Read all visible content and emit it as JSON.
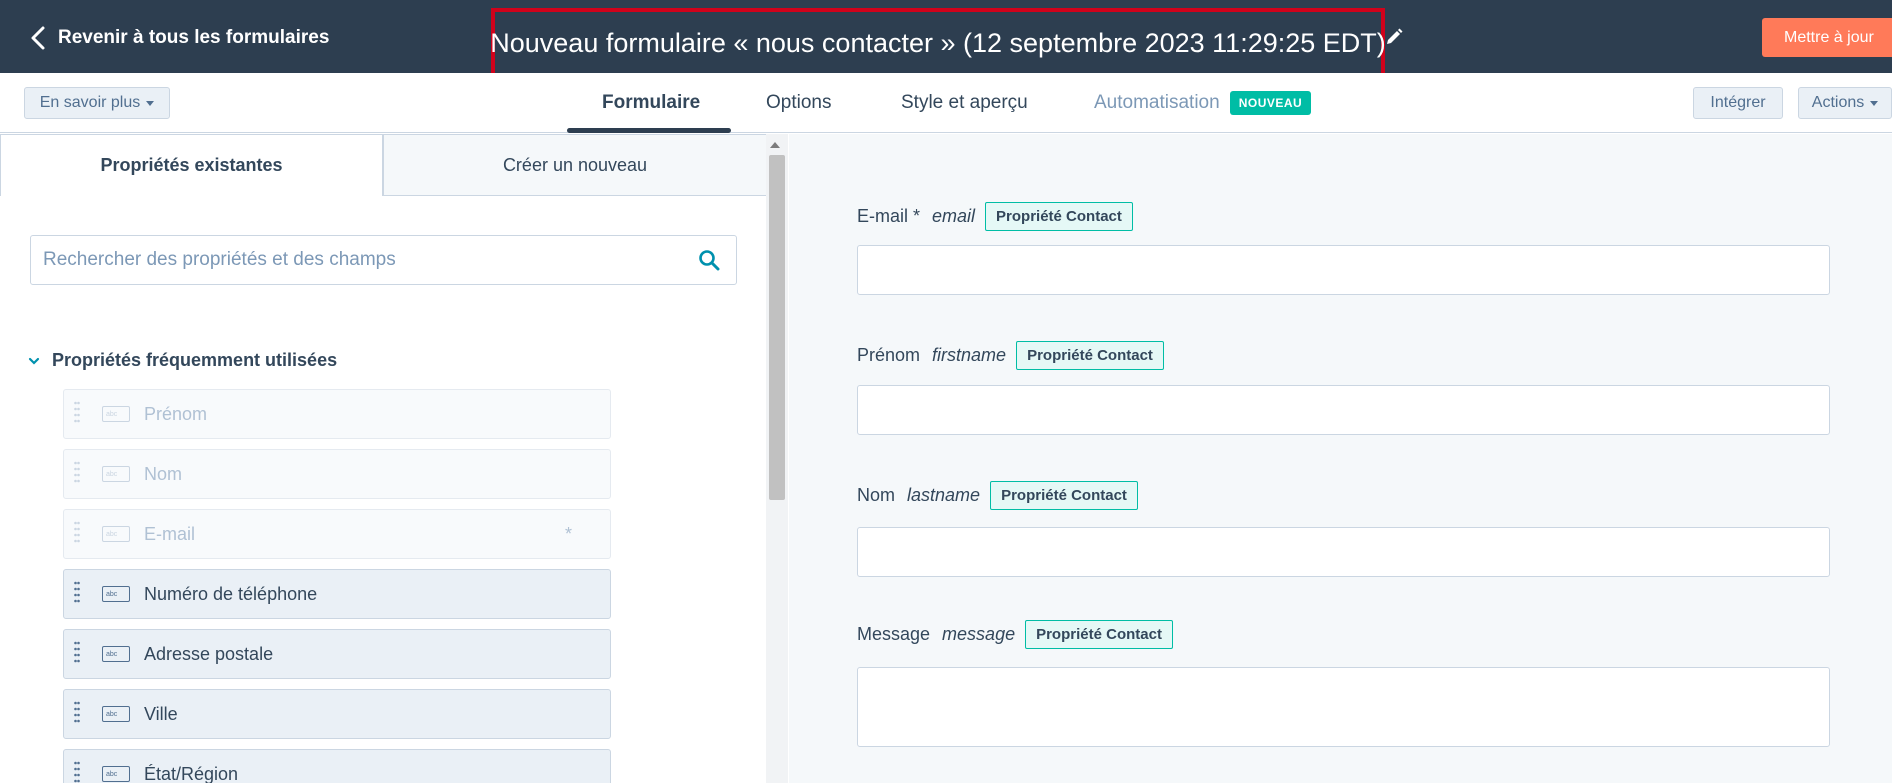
{
  "header": {
    "back_label": "Revenir à tous les formulaires",
    "title": "Nouveau formulaire « nous contacter » (12 septembre 2023 11:29:25 EDT)",
    "update_label": "Mettre à jour"
  },
  "nav": {
    "learn_more": "En savoir plus",
    "tabs": [
      {
        "label": "Formulaire"
      },
      {
        "label": "Options"
      },
      {
        "label": "Style et aperçu"
      },
      {
        "label": "Automatisation"
      }
    ],
    "new_badge": "NOUVEAU",
    "embed": "Intégrer",
    "actions": "Actions"
  },
  "left": {
    "tab_existing": "Propriétés existantes",
    "tab_create": "Créer un nouveau",
    "search_placeholder": "Rechercher des propriétés et des champs",
    "section_title": "Propriétés fréquemment utilisées",
    "field_icon_text": "abc",
    "props": [
      {
        "label": "Prénom",
        "state": "disabled",
        "required": false
      },
      {
        "label": "Nom",
        "state": "disabled",
        "required": false
      },
      {
        "label": "E-mail",
        "state": "disabled",
        "required": true
      },
      {
        "label": "Numéro de téléphone",
        "state": "enabled",
        "required": false
      },
      {
        "label": "Adresse postale",
        "state": "enabled",
        "required": false
      },
      {
        "label": "Ville",
        "state": "enabled",
        "required": false
      },
      {
        "label": "État/Région",
        "state": "enabled",
        "required": false
      }
    ],
    "required_mark": "*"
  },
  "preview": {
    "badge": "Propriété Contact",
    "fields": [
      {
        "label": "E-mail *",
        "internal": "email"
      },
      {
        "label": "Prénom",
        "internal": "firstname"
      },
      {
        "label": "Nom",
        "internal": "lastname"
      },
      {
        "label": "Message",
        "internal": "message"
      }
    ]
  },
  "colors": {
    "header_bg": "#2d3e50",
    "accent_orange": "#ff7a59",
    "teal": "#00bda5",
    "highlight_red": "#d0021b"
  }
}
